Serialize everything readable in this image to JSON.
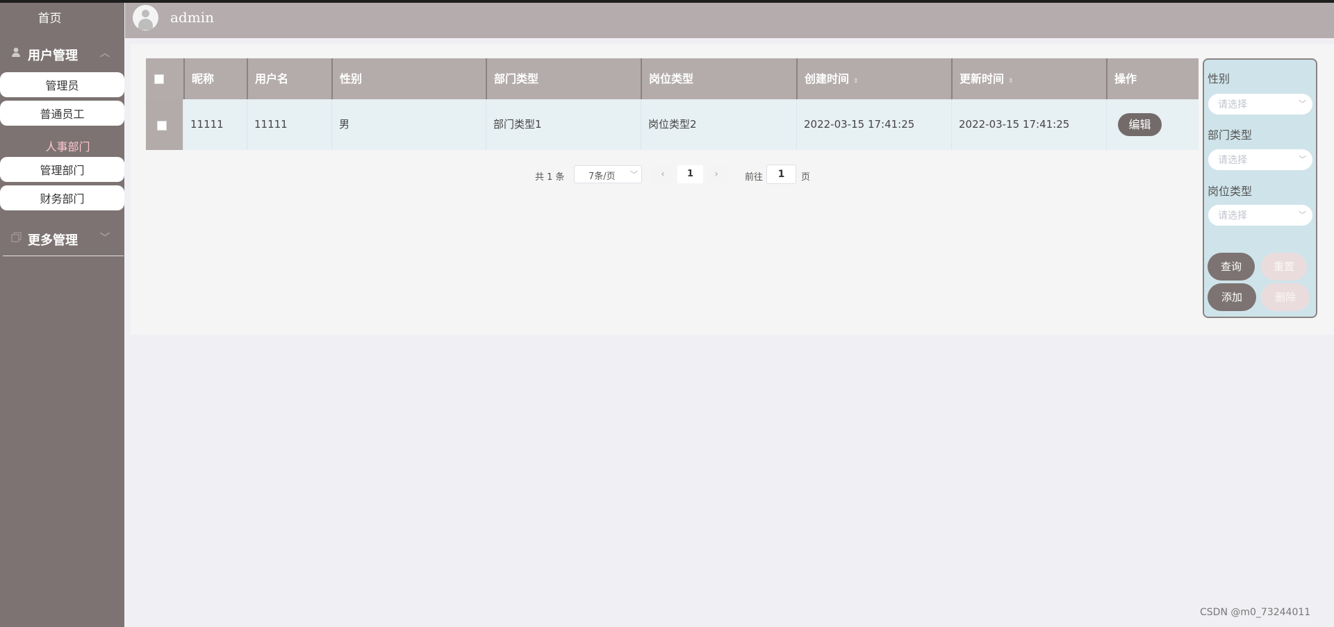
{
  "sidebar": {
    "home": "首页",
    "groups": [
      {
        "label": "用户管理",
        "items": [
          "管理员",
          "普通员工"
        ]
      },
      {
        "label": "人事部门",
        "items": [
          "管理部门",
          "财务部门"
        ]
      },
      {
        "label": "更多管理",
        "items": []
      }
    ]
  },
  "header": {
    "username": "admin"
  },
  "table": {
    "columns": [
      "昵称",
      "用户名",
      "性别",
      "部门类型",
      "岗位类型",
      "创建时间",
      "更新时间",
      "操作"
    ],
    "sort_icon": "⇕",
    "rows": [
      {
        "nickname": "11111",
        "username": "11111",
        "gender": "男",
        "department_type": "部门类型1",
        "position_type": "岗位类型2",
        "created_at": "2022-03-15 17:41:25",
        "updated_at": "2022-03-15 17:41:25",
        "edit_label": "编辑"
      }
    ]
  },
  "pagination": {
    "total": "共 1 条",
    "page_size": "7条/页",
    "prev": "‹",
    "current_page": "1",
    "next": "›",
    "goto_label": "前往",
    "goto_value": "1",
    "page_unit": "页"
  },
  "filters": {
    "fields": [
      {
        "label": "性别",
        "placeholder": "请选择"
      },
      {
        "label": "部门类型",
        "placeholder": "请选择"
      },
      {
        "label": "岗位类型",
        "placeholder": "请选择"
      }
    ],
    "query_label": "查询",
    "reset_label": "重置",
    "add_label": "添加",
    "delete_label": "删除"
  },
  "watermark": "CSDN @m0_73244011",
  "colors": {
    "sidebar_bg": "#7c7372",
    "header_bg": "#b5adad",
    "table_header_bg": "#b4acab",
    "row_bg": "#e7f0f3",
    "filter_bg": "#cfe4ea",
    "active_menu": "#ffc6cf"
  }
}
